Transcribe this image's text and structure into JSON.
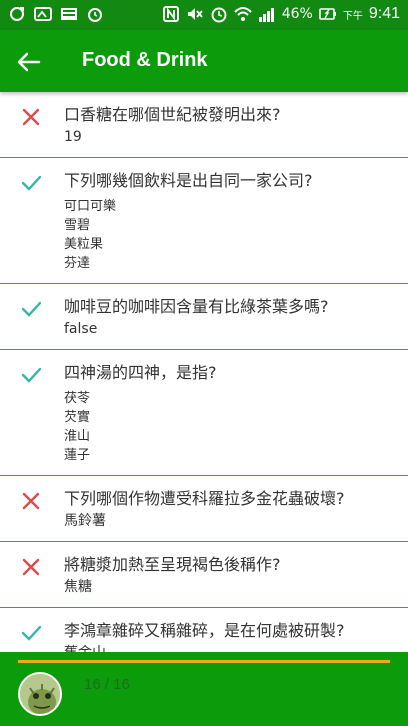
{
  "status_bar": {
    "battery": "46%",
    "time_prefix": "下午",
    "time": "9:41",
    "icons": [
      "sync-icon",
      "photo-icon",
      "screen-icon",
      "alarm-icon",
      "nfc-icon",
      "mute-icon",
      "clock-icon",
      "wifi-icon",
      "signal-icon",
      "battery-icon"
    ]
  },
  "app_bar": {
    "title": "Food & Drink",
    "back_icon": "arrow-left-icon"
  },
  "colors": {
    "status_green": "#128a12",
    "bar_green": "#0b9b0b",
    "correct": "#35b8a3",
    "wrong": "#e04a4a",
    "progress": "#f3a81a"
  },
  "items": [
    {
      "result": "wrong",
      "question": "口香糖在哪個世紀被發明出來?",
      "answers": [
        "19"
      ]
    },
    {
      "result": "correct",
      "question": "下列哪幾個飲料是出自同一家公司?",
      "answers": [
        "可口可樂",
        "雪碧",
        "美粒果",
        "芬達"
      ]
    },
    {
      "result": "correct",
      "question": "咖啡豆的咖啡因含量有比綠茶葉多嗎?",
      "answers": [
        "false"
      ]
    },
    {
      "result": "correct",
      "question": "四神湯的四神，是指?",
      "answers": [
        "茯苓",
        "芡實",
        "淮山",
        "蓮子"
      ]
    },
    {
      "result": "wrong",
      "question": "下列哪個作物遭受科羅拉多金花蟲破壞?",
      "answers": [
        "馬鈴薯"
      ]
    },
    {
      "result": "wrong",
      "question": "將糖漿加熱至呈現褐色後稱作?",
      "answers": [
        "焦糖"
      ]
    },
    {
      "result": "correct",
      "question": "李鴻章雜碎又稱雜碎，是在何處被研製?",
      "answers": [
        "舊金山"
      ]
    }
  ],
  "footer": {
    "score": "16 / 16"
  }
}
